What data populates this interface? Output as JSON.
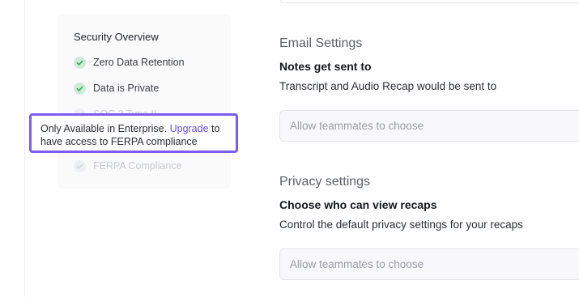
{
  "security": {
    "title": "Security Overview",
    "items": [
      {
        "label": "Zero Data Retention",
        "checked": true
      },
      {
        "label": "Data is Private",
        "checked": true
      },
      {
        "label": "SOC 2 Type II",
        "checked": false
      },
      {
        "label": "FERPA Compliance",
        "checked": false
      }
    ]
  },
  "tooltip": {
    "prefix": "Only Available in Enterprise.",
    "link": "Upgrade",
    "suffix_line1": "to",
    "line2": "have access to FERPA compliance"
  },
  "email": {
    "title": "Email Settings",
    "heading": "Notes get sent to",
    "description": "Transcript and Audio Recap would be sent to",
    "select_value": "Allow teammates to choose"
  },
  "privacy": {
    "title": "Privacy settings",
    "heading": "Choose who can view recaps",
    "description": "Control the default privacy settings for your recaps",
    "select_value": "Allow teammates to choose"
  },
  "colors": {
    "accent": "#7b5cf0",
    "link": "#6a4de8",
    "check_bg": "#cdebd6",
    "check_mark": "#2fa35a"
  }
}
